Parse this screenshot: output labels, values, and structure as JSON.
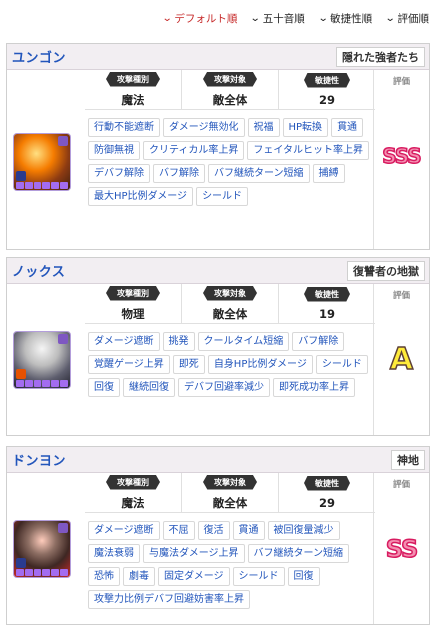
{
  "sort": {
    "items": [
      {
        "label": "デフォルト順",
        "active": true
      },
      {
        "label": "五十音順",
        "active": false
      },
      {
        "label": "敏捷性順",
        "active": false
      },
      {
        "label": "評価順",
        "active": false
      }
    ]
  },
  "stat_labels": {
    "type": "攻撃種別",
    "target": "攻撃対象",
    "agility": "敏捷性"
  },
  "rating_label": "評価",
  "characters": [
    {
      "name": "ユンゴン",
      "title": "隠れた強者たち",
      "type": "魔法",
      "target": "敵全体",
      "agility": "29",
      "rating": "SSS",
      "tags": [
        "行動不能遮断",
        "ダメージ無効化",
        "祝福",
        "HP転換",
        "貫通",
        "防御無視",
        "クリティカル率上昇",
        "フェイタルヒット率上昇",
        "デバフ解除",
        "バフ解除",
        "バフ継続ターン短縮",
        "捕縛",
        "最大HP比例ダメージ",
        "シールド"
      ]
    },
    {
      "name": "ノックス",
      "title": "復讐者の地獄",
      "type": "物理",
      "target": "敵全体",
      "agility": "19",
      "rating": "A",
      "tags": [
        "ダメージ遮断",
        "挑発",
        "クールタイム短縮",
        "バフ解除",
        "覚醒ゲージ上昇",
        "即死",
        "自身HP比例ダメージ",
        "シールド",
        "回復",
        "継続回復",
        "デバフ回避率減少",
        "即死成功率上昇"
      ]
    },
    {
      "name": "ドンヨン",
      "title": "神地",
      "type": "魔法",
      "target": "敵全体",
      "agility": "29",
      "rating": "SS",
      "tags": [
        "ダメージ遮断",
        "不屈",
        "復活",
        "貫通",
        "被回復量減少",
        "魔法衰弱",
        "与魔法ダメージ上昇",
        "バフ継続ターン短縮",
        "恐怖",
        "劇毒",
        "固定ダメージ",
        "シールド",
        "回復",
        "攻撃力比例デバフ回避妨害率上昇"
      ]
    }
  ]
}
